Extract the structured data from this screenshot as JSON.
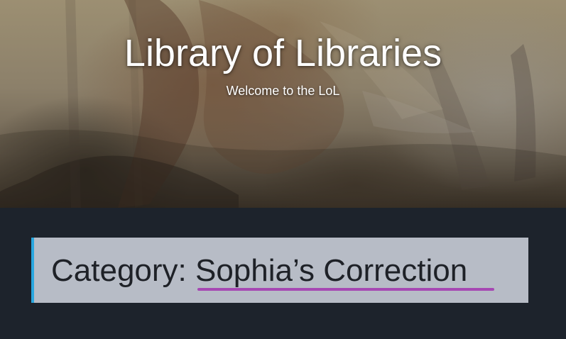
{
  "site": {
    "title": "Library of Libraries",
    "tagline": "Welcome to the LoL"
  },
  "archive": {
    "prefix": "Category: ",
    "name": "Sophia’s Correction"
  },
  "colors": {
    "header_overlay": "#7d735f",
    "content_background": "#1d232c",
    "category_box": "#b7bcc6",
    "category_border": "#2aa7df",
    "category_underline": "#a648b3",
    "category_text": "#1e2127",
    "title_text": "#ffffff"
  },
  "icons": {
    "header_image": "painted-harbor-image"
  }
}
